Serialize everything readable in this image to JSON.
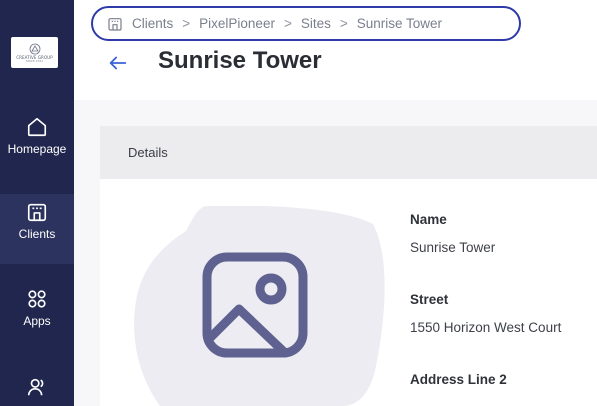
{
  "sidebar": {
    "logo": {
      "text": "CREATIVE GROUP",
      "subtext": "SINCE 2021",
      "icon": "logo-mark-icon"
    },
    "items": [
      {
        "label": "Homepage",
        "icon": "home-icon",
        "active": false
      },
      {
        "label": "Clients",
        "icon": "building-icon",
        "active": true
      },
      {
        "label": "Apps",
        "icon": "apps-grid-icon",
        "active": false
      },
      {
        "label": "",
        "icon": "users-icon",
        "active": false
      }
    ],
    "colors": {
      "background": "#20264d",
      "active": "#2c335e"
    }
  },
  "header": {
    "breadcrumb": {
      "icon": "building-icon",
      "items": [
        "Clients",
        "PixelPioneer",
        "Sites",
        "Sunrise Tower"
      ],
      "separator": ">"
    },
    "back_icon": "arrow-left-icon",
    "title": "Sunrise Tower"
  },
  "details": {
    "section_title": "Details",
    "image_placeholder_icon": "image-placeholder-icon",
    "fields": [
      {
        "label": "Name",
        "value": "Sunrise Tower"
      },
      {
        "label": "Street",
        "value": "1550 Horizon West Court"
      },
      {
        "label": "Address Line 2",
        "value": ""
      }
    ]
  },
  "colors": {
    "accent": "#3b63d9",
    "breadcrumb_border": "#2e3aa8",
    "placeholder_fill": "#ececf2",
    "placeholder_icon": "#5f6291"
  }
}
